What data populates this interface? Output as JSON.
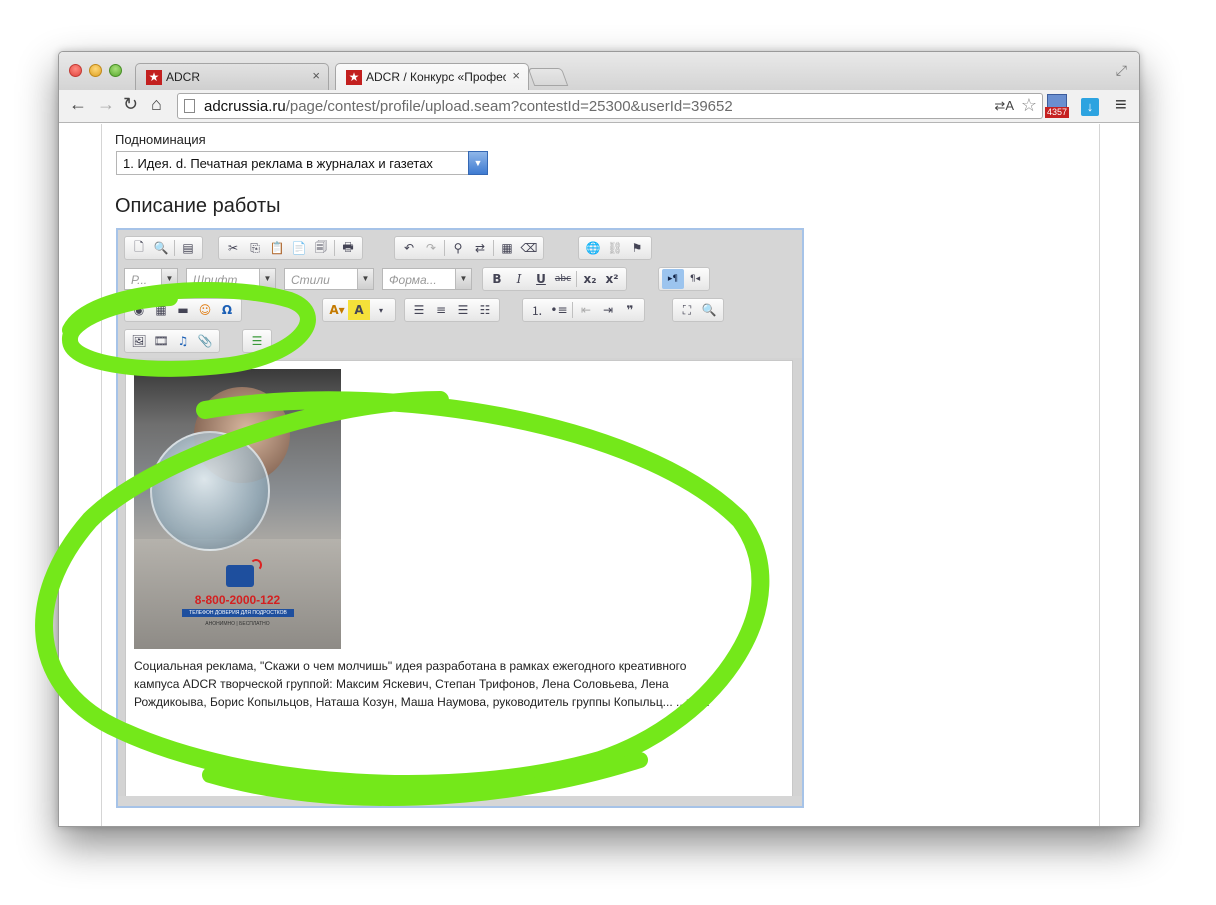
{
  "browser": {
    "tabs": [
      {
        "favicon": "★",
        "title": "ADCR",
        "close": "×"
      },
      {
        "favicon": "★",
        "title": "ADCR / Конкурс «Профес",
        "close": "×"
      }
    ],
    "url_host": "adcrussia.ru",
    "url_path": "/page/contest/profile/upload.seam?contestId=25300&userId=39652",
    "translate_glyph": "⇄A",
    "mail_badge": "4357"
  },
  "form": {
    "subnomination_label": "Подноминация",
    "subnomination_value": "1. Идея. d. Печатная реклама в журналах и газетах",
    "description_title": "Описание работы"
  },
  "editor": {
    "combos": {
      "para": "Р...",
      "font": "Шрифт",
      "styles": "Стили",
      "format": "Форма..."
    },
    "toolbar_labels": {
      "bold": "B",
      "italic": "I",
      "underline": "U",
      "strike": "abc",
      "subscript": "x₂",
      "superscript": "x²",
      "ltr": "▸¶",
      "rtl": "¶◂",
      "quote": "❞",
      "omega": "Ω"
    },
    "poster": {
      "phone": "8-800-2000-122",
      "line2": "ТЕЛЕФОН ДОВЕРИЯ ДЛЯ ПОДРОСТКОВ",
      "line3": "АНОНИМНО | БЕСПЛАТНО"
    },
    "description_text": "Социальная реклама, \"Скажи о чем молчишь\" идея разработана в рамках ежегодного креативного кампуса ADCR творческой группой: Максим Яскевич, Степан Трифонов, Лена Соловьева, Лена Рождикоыва, Борис Копыльцов, Наташа Козун, Маша Наумова, руководитель группы Копыльц... ...ндр."
  },
  "colors": {
    "scribble": "#74e81a",
    "select_button": "#3f7bd1",
    "favicon": "#c3201f"
  }
}
